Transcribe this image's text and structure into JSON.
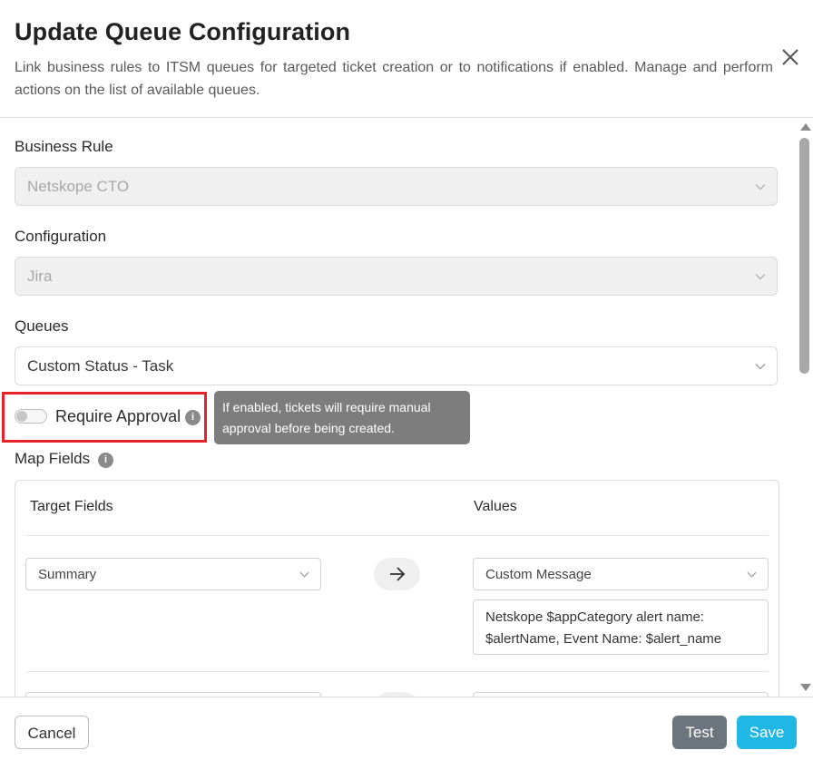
{
  "dialog": {
    "title": "Update Queue Configuration",
    "description": "Link business rules to ITSM queues for targeted ticket creation or to notifications if enabled. Manage and perform actions on the list of available queues."
  },
  "form": {
    "business_rule": {
      "label": "Business Rule",
      "value": "Netskope CTO"
    },
    "configuration": {
      "label": "Configuration",
      "value": "Jira"
    },
    "queues": {
      "label": "Queues",
      "value": "Custom Status - Task"
    },
    "require_approval": {
      "label": "Require Approval",
      "enabled": false,
      "tooltip": "If enabled, tickets will require manual approval before being created."
    },
    "map_fields": {
      "label": "Map Fields",
      "headers": {
        "target": "Target Fields",
        "values": "Values"
      },
      "rows": [
        {
          "target": "Summary",
          "value_type": "Custom Message",
          "message": "Netskope $appCategory alert name: $alertName, Event Name: $alert_name"
        }
      ]
    }
  },
  "footer": {
    "cancel_label": "Cancel",
    "test_label": "Test",
    "save_label": "Save"
  },
  "colors": {
    "accent": "#20b7e5",
    "secondary": "#6c757d",
    "highlight": "#e8222b"
  }
}
